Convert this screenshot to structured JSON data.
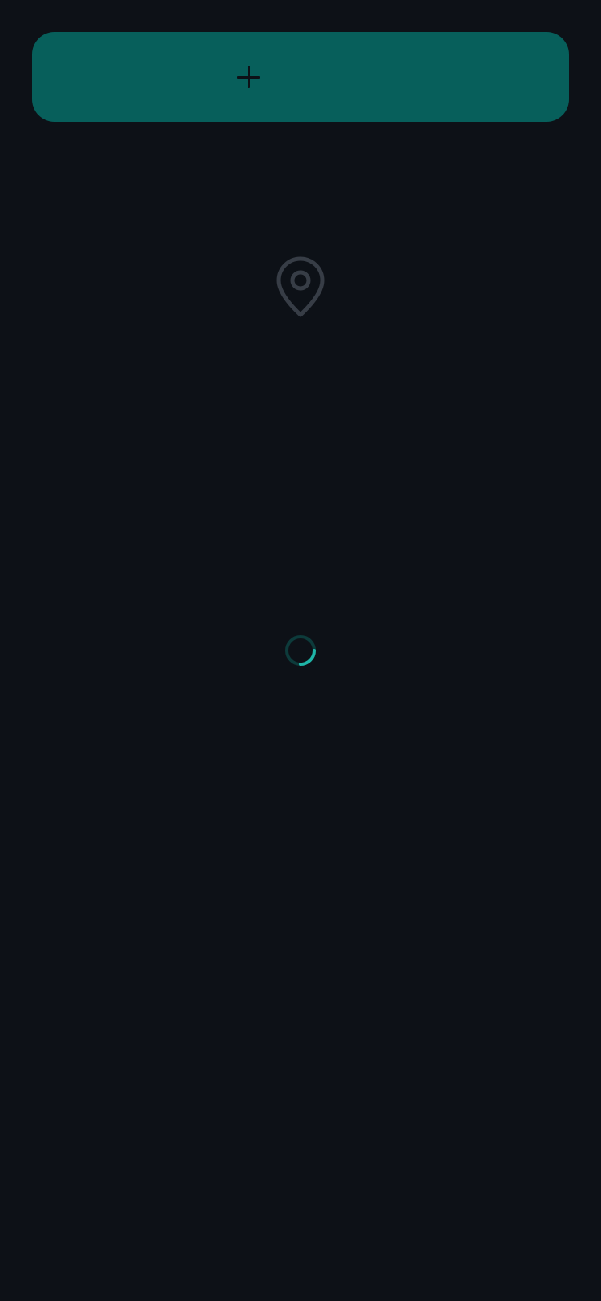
{
  "screen": {
    "background_color": "#0d1117"
  },
  "add_button": {
    "icon": "plus-icon",
    "background_color": "#075f5b",
    "icon_color": "#0d1117"
  },
  "empty_state": {
    "icon": "location-pin-icon",
    "icon_color": "#373d46"
  },
  "loading": {
    "icon": "loading-spinner",
    "track_color": "#0d3b3b",
    "accent_color": "#1fb5a8",
    "progress": 0.25
  }
}
